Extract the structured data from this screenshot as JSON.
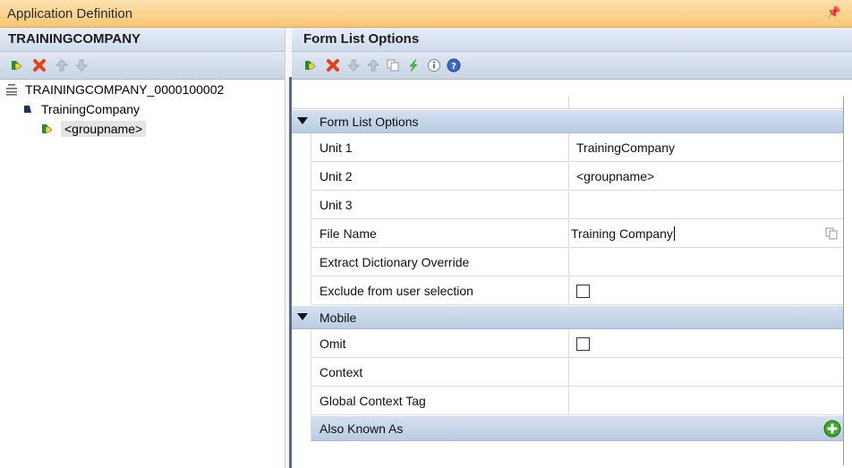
{
  "window": {
    "title": "Application Definition",
    "pin_icon": "pin-icon"
  },
  "left_pane": {
    "header": "TRAININGCOMPANY",
    "toolbar": [
      "add-icon",
      "delete-icon",
      "move-up-icon",
      "move-down-icon"
    ],
    "tree": [
      {
        "label": "TRAININGCOMPANY_0000100002",
        "icon": "dictionary-icon",
        "level": 0
      },
      {
        "label": "TrainingCompany",
        "icon": "record-icon",
        "level": 1
      },
      {
        "label": "<groupname>",
        "icon": "group-icon",
        "level": 2,
        "selected": true
      }
    ]
  },
  "right_pane": {
    "header": "Form List Options",
    "toolbar": [
      "add-icon",
      "delete-icon",
      "move-down-icon",
      "move-up-icon",
      "copy-icon",
      "run-icon",
      "info-icon",
      "help-icon"
    ],
    "sections": [
      {
        "label": "Form List Options",
        "rows": [
          {
            "name": "Unit 1",
            "value": "TrainingCompany"
          },
          {
            "name": "Unit 2",
            "value": "<groupname>"
          },
          {
            "name": "Unit 3",
            "value": ""
          },
          {
            "name": "File Name",
            "value": "Training Company"
          },
          {
            "name": "Extract Dictionary Override",
            "value": ""
          },
          {
            "name": "Exclude from user selection",
            "checked": false
          }
        ]
      },
      {
        "label": "Mobile",
        "rows": [
          {
            "name": "Omit",
            "checked": false
          },
          {
            "name": "Context",
            "value": ""
          },
          {
            "name": "Global Context Tag",
            "value": ""
          }
        ]
      }
    ],
    "also_known_as": "Also Known As"
  },
  "colors": {
    "titlebar": "#f9c774",
    "header": "#cfdaea",
    "category": "#b9cbe3",
    "delete": "#e0441c",
    "add_green": "#3aa92e"
  }
}
